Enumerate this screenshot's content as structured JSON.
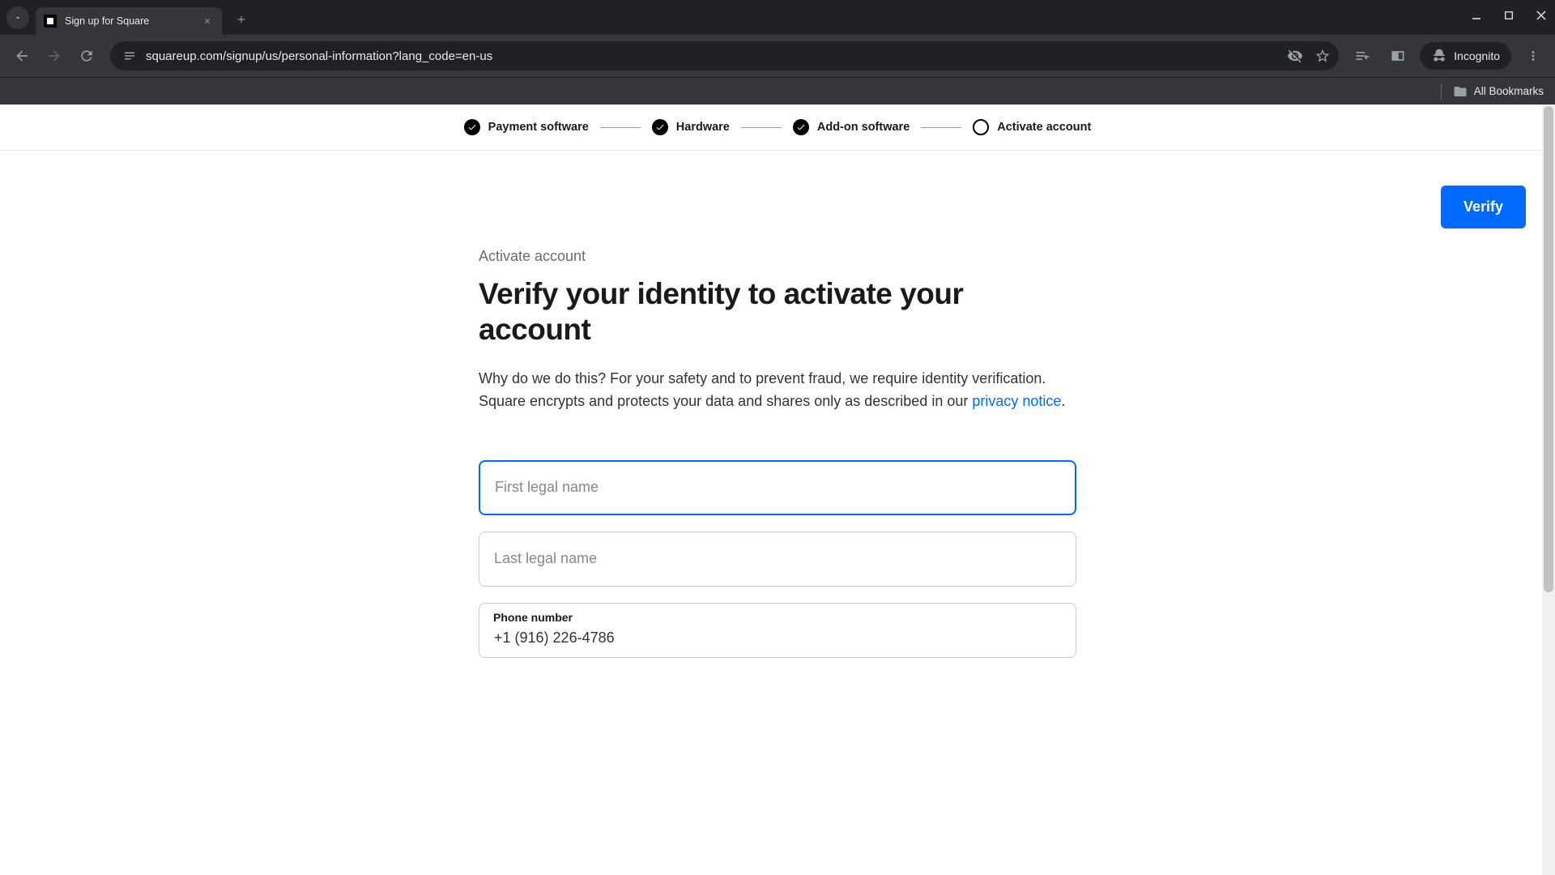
{
  "browser": {
    "tab_title": "Sign up for Square",
    "url": "squareup.com/signup/us/personal-information?lang_code=en-us",
    "incognito": "Incognito",
    "all_bookmarks": "All Bookmarks"
  },
  "stepper": {
    "steps": [
      {
        "label": "Payment software",
        "state": "done"
      },
      {
        "label": "Hardware",
        "state": "done"
      },
      {
        "label": "Add-on software",
        "state": "done"
      },
      {
        "label": "Activate account",
        "state": "active"
      }
    ]
  },
  "actions": {
    "verify": "Verify"
  },
  "content": {
    "breadcrumb": "Activate account",
    "heading": "Verify your identity to activate your account",
    "description_pre": "Why do we do this? For your safety and to prevent fraud, we require identity verification. Square encrypts and protects your data and shares only as described in our ",
    "privacy_link": "privacy notice",
    "description_post": "."
  },
  "form": {
    "first_name": {
      "placeholder": "First legal name",
      "value": ""
    },
    "last_name": {
      "placeholder": "Last legal name",
      "value": ""
    },
    "phone": {
      "label": "Phone number",
      "value": "+1 (916) 226-4786"
    }
  },
  "colors": {
    "accent": "#006aff",
    "chrome_dark": "#202124",
    "chrome_grey": "#35363a"
  }
}
